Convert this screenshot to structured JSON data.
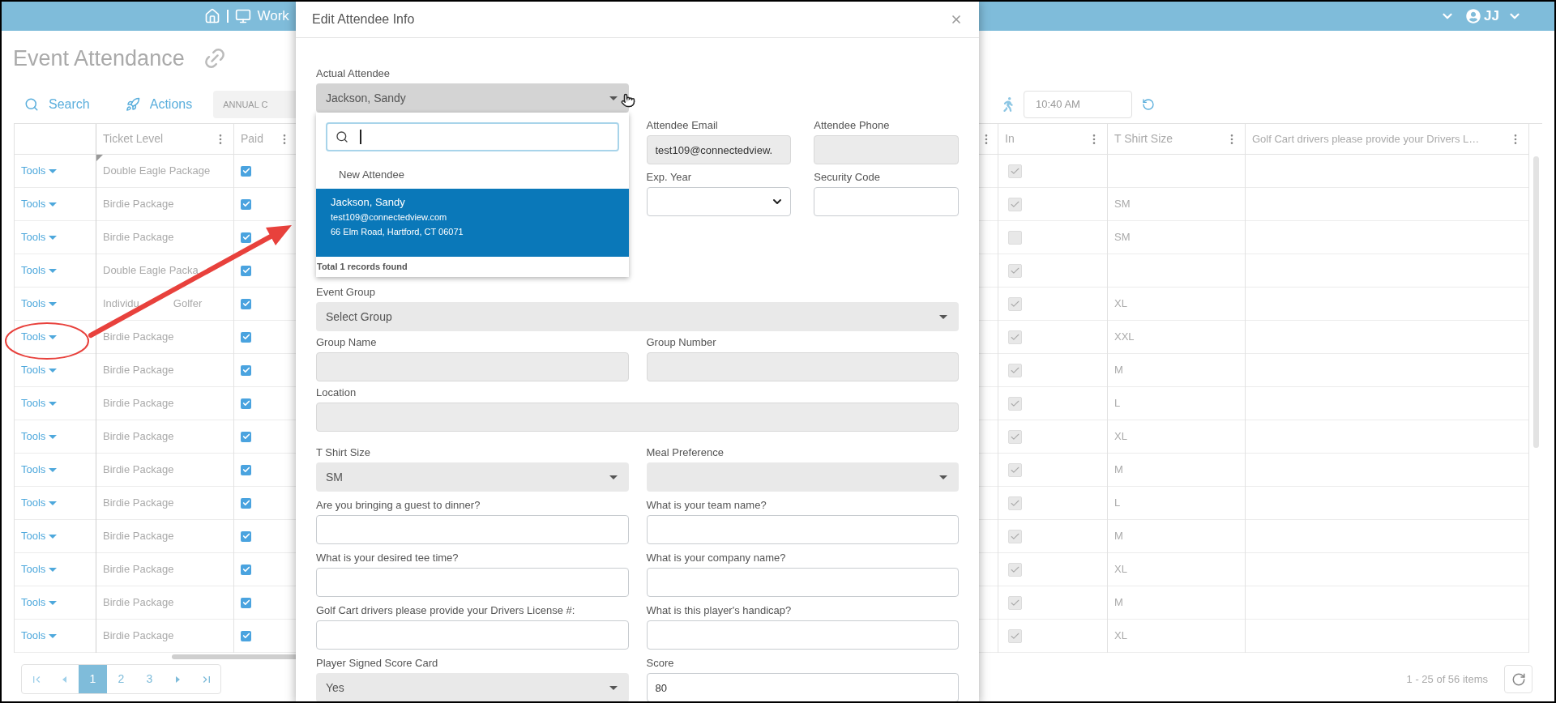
{
  "top_bar": {
    "nav_text": "Work",
    "user_initials": "JJ"
  },
  "page": {
    "title": "Event Attendance"
  },
  "toolbar": {
    "search_label": "Search",
    "actions_label": "Actions",
    "filter_value": "ANNUAL C",
    "time_value": "10:40 AM"
  },
  "table": {
    "left_columns": [
      "Ticket Level",
      "Paid"
    ],
    "right_columns": [
      "In",
      "T Shirt Size",
      "Golf Cart drivers please provide your Drivers L…"
    ],
    "rows": [
      {
        "tools": "Tools",
        "ticket_level": "Double Eagle Package",
        "paid": true,
        "in": true,
        "edited": true
      },
      {
        "tools": "Tools",
        "ticket_level": "Birdie Package",
        "paid": true,
        "in": true,
        "t_shirt_size": "SM",
        "edited": false
      },
      {
        "tools": "Tools",
        "ticket_level": "Birdie Package",
        "paid": true,
        "in": false,
        "t_shirt_size": "SM",
        "edited": false
      },
      {
        "tools": "Tools",
        "ticket_level": "Double Eagle Packa",
        "paid": true,
        "in": true,
        "edited": false
      },
      {
        "tools": "Tools",
        "ticket_level": "Individu",
        "ticket_level_rest": "Golfer",
        "paid": true,
        "in": true,
        "t_shirt_size": "XL",
        "edited": false
      },
      {
        "tools": "Tools",
        "ticket_level": "Birdie Package",
        "paid": true,
        "in": true,
        "t_shirt_size": "XXL",
        "edited": false
      },
      {
        "tools": "Tools",
        "ticket_level": "Birdie Package",
        "paid": true,
        "in": true,
        "t_shirt_size": "M",
        "edited": false
      },
      {
        "tools": "Tools",
        "ticket_level": "Birdie Package",
        "paid": true,
        "in": true,
        "t_shirt_size": "L",
        "edited": false
      },
      {
        "tools": "Tools",
        "ticket_level": "Birdie Package",
        "paid": true,
        "in": true,
        "t_shirt_size": "XL",
        "edited": false
      },
      {
        "tools": "Tools",
        "ticket_level": "Birdie Package",
        "paid": true,
        "in": true,
        "t_shirt_size": "M",
        "edited": false
      },
      {
        "tools": "Tools",
        "ticket_level": "Birdie Package",
        "paid": true,
        "in": true,
        "t_shirt_size": "L",
        "edited": false
      },
      {
        "tools": "Tools",
        "ticket_level": "Birdie Package",
        "paid": true,
        "in": true,
        "t_shirt_size": "M",
        "edited": false
      },
      {
        "tools": "Tools",
        "ticket_level": "Birdie Package",
        "paid": true,
        "in": true,
        "t_shirt_size": "XL",
        "edited": false
      },
      {
        "tools": "Tools",
        "ticket_level": "Birdie Package",
        "paid": true,
        "in": true,
        "t_shirt_size": "M",
        "edited": false
      },
      {
        "tools": "Tools",
        "ticket_level": "Birdie Package",
        "paid": true,
        "in": true,
        "t_shirt_size": "XL",
        "edited": false
      }
    ]
  },
  "pagination": {
    "pages": [
      {
        "label": "1",
        "selected": true
      },
      {
        "label": "2",
        "selected": false
      },
      {
        "label": "3",
        "selected": false
      }
    ],
    "summary": "1 - 25 of 56 items"
  },
  "dialog": {
    "title": "Edit Attendee Info",
    "attendee": {
      "label": "Actual Attendee",
      "value": "Jackson, Sandy"
    },
    "attendee_dropdown": {
      "options": [
        {
          "kind": "new",
          "name": "New Attendee",
          "selected": false
        },
        {
          "kind": "person",
          "name": "Jackson, Sandy",
          "email": "test109@connectedview.com",
          "address": "66 Elm Road, Hartford, CT 06071",
          "selected": true
        }
      ],
      "footer": "Total 1 records found"
    },
    "contact_rows": [
      [
        {
          "kind": "input",
          "label": "Attendee Email",
          "value": "test109@connectedview.",
          "disabled": true
        },
        {
          "kind": "input",
          "label": "Attendee Phone",
          "disabled": true
        }
      ],
      [
        {
          "kind": "native_select",
          "label": "Exp. Year"
        },
        {
          "kind": "input",
          "label": "Security Code",
          "disabled": false
        }
      ]
    ],
    "group_rows": [
      [
        {
          "kind": "select",
          "label": "Event Group",
          "value": "Select Group"
        }
      ],
      [
        {
          "kind": "input",
          "label": "Group Name",
          "disabled": true
        },
        {
          "kind": "input",
          "label": "Group Number",
          "disabled": true
        }
      ],
      [
        {
          "kind": "input",
          "label": "Location",
          "disabled": true
        }
      ]
    ],
    "question_rows": [
      [
        {
          "kind": "select",
          "label": "T Shirt Size",
          "value": "SM"
        },
        {
          "kind": "select",
          "label": "Meal Preference"
        }
      ],
      [
        {
          "kind": "input",
          "label": "Are you bringing a guest to dinner?",
          "disabled": false
        },
        {
          "kind": "input",
          "label": "What is your team name?",
          "disabled": false
        }
      ],
      [
        {
          "kind": "input",
          "label": "What is your desired tee time?",
          "disabled": false
        },
        {
          "kind": "input",
          "label": "What is your company name?",
          "disabled": false
        }
      ],
      [
        {
          "kind": "input",
          "label": "Golf Cart drivers please provide your Drivers License #:",
          "disabled": false
        },
        {
          "kind": "input",
          "label": "What is this player's handicap?",
          "disabled": false
        }
      ],
      [
        {
          "kind": "select",
          "label": "Player Signed Score Card",
          "value": "Yes"
        },
        {
          "kind": "input",
          "label": "Score",
          "value": "80",
          "disabled": false
        }
      ]
    ]
  }
}
